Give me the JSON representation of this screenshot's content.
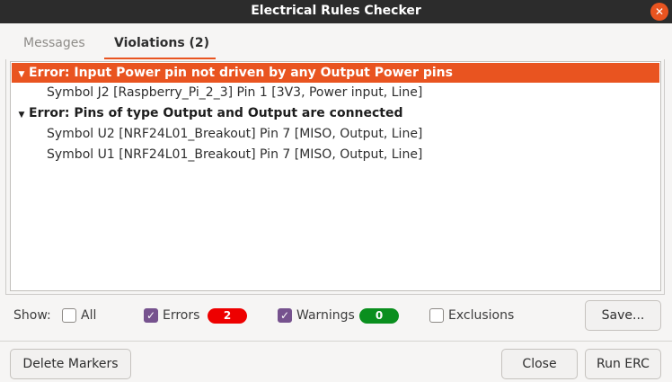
{
  "window": {
    "title": "Electrical Rules Checker"
  },
  "tabs": [
    {
      "label": "Messages"
    },
    {
      "label": "Violations (2)"
    }
  ],
  "violations": [
    {
      "label": "Error: Input Power pin not driven by any Output Power pins",
      "items": [
        "Symbol J2 [Raspberry_Pi_2_3] Pin 1 [3V3, Power input, Line]"
      ]
    },
    {
      "label": "Error: Pins of type Output and Output are connected",
      "items": [
        "Symbol U2 [NRF24L01_Breakout] Pin 7 [MISO, Output, Line]",
        "Symbol U1 [NRF24L01_Breakout] Pin 7 [MISO, Output, Line]"
      ]
    }
  ],
  "filters": {
    "show_label": "Show:",
    "all": {
      "label": "All",
      "checked": false
    },
    "errors": {
      "label": "Errors",
      "checked": true,
      "count": "2",
      "color": "#ee0000"
    },
    "warnings": {
      "label": "Warnings",
      "checked": true,
      "count": "0",
      "color": "#0a8f1e"
    },
    "exclusions": {
      "label": "Exclusions",
      "checked": false
    },
    "save_label": "Save..."
  },
  "footer": {
    "delete_label": "Delete Markers",
    "close_label": "Close",
    "run_label": "Run ERC"
  },
  "colors": {
    "accent": "#e95420",
    "checkbox": "#76528e"
  }
}
